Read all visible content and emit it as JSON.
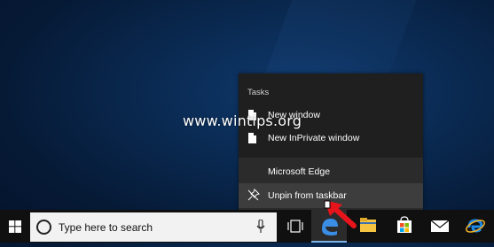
{
  "watermark": "www.wintips.org",
  "jumplist": {
    "heading": "Tasks",
    "tasks": [
      {
        "label": "New window",
        "icon": "document-icon"
      },
      {
        "label": "New InPrivate window",
        "icon": "document-icon"
      }
    ],
    "app_name": "Microsoft Edge",
    "unpin_label": "Unpin from taskbar",
    "unpin_icon": "unpin-icon"
  },
  "taskbar": {
    "start_icon": "windows-logo-icon",
    "search": {
      "placeholder": "Type here to search",
      "icon": "cortana-circle-icon",
      "mic_icon": "microphone-icon"
    },
    "task_view_icon": "task-view-icon",
    "pinned_apps": [
      {
        "name": "edge",
        "icon": "edge-icon",
        "active": true
      },
      {
        "name": "file-explorer",
        "icon": "folder-icon"
      },
      {
        "name": "store",
        "icon": "store-bag-icon"
      },
      {
        "name": "mail",
        "icon": "mail-icon"
      },
      {
        "name": "internet-explorer",
        "icon": "internet-explorer-icon"
      }
    ]
  },
  "colors": {
    "desktop_blue": "#0a2a52",
    "taskbar": "#101010",
    "jumplist_bg": "#1f1f1f",
    "highlight": "#3d3d3d",
    "arrow": "#e8141b"
  }
}
